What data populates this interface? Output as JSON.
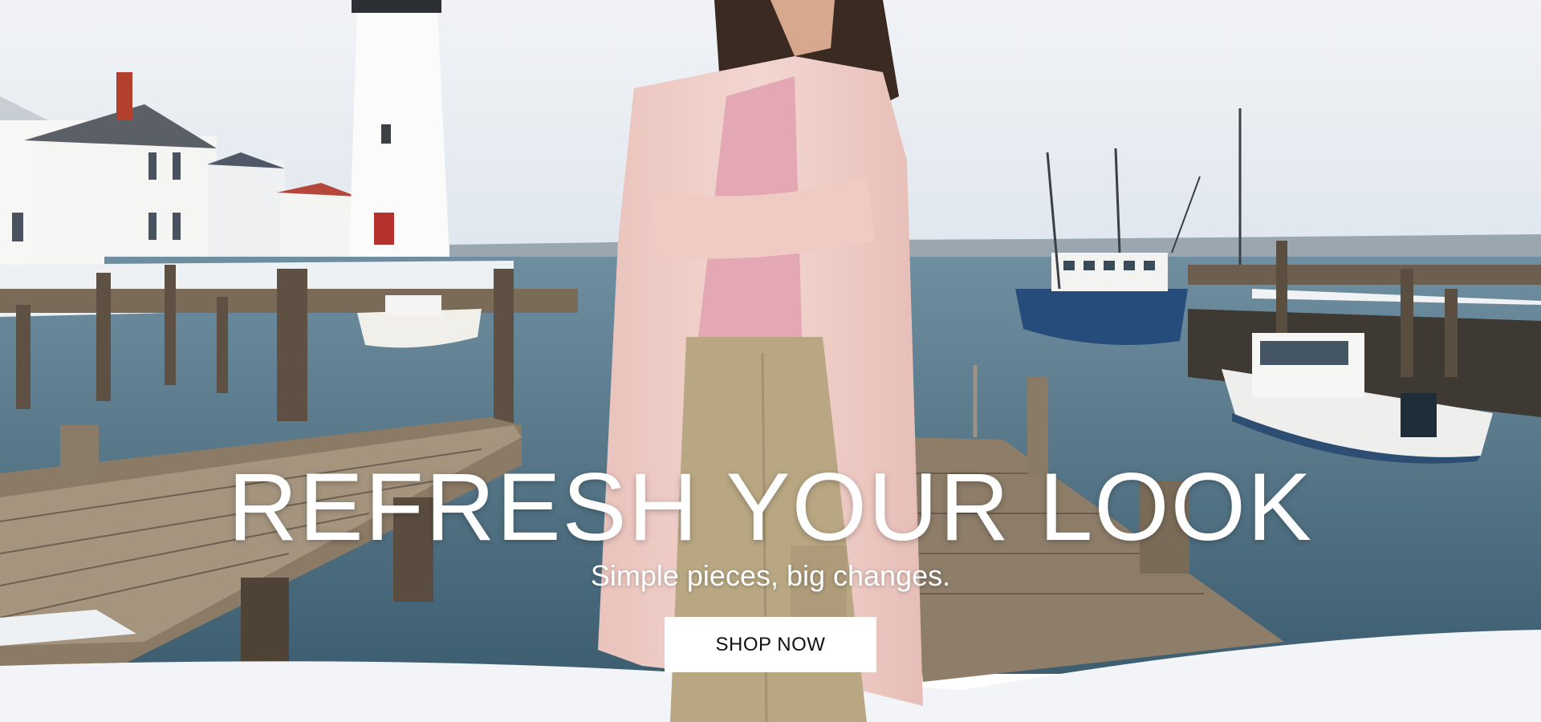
{
  "hero": {
    "headline": "REFRESH YOUR LOOK",
    "subheadline": "Simple pieces, big changes.",
    "cta_label": "SHOP NOW"
  },
  "image": {
    "description_tags": [
      "lighthouse",
      "houses",
      "wooden-pier",
      "boats",
      "harbor",
      "snow",
      "model-in-pink-coat"
    ]
  },
  "colors": {
    "sky": "#e6ecf2",
    "water": "#4d6f80",
    "snow": "#f4f6f8",
    "coat": "#efcfc9",
    "pants": "#bba98a",
    "button_bg": "#ffffff",
    "button_text": "#111111",
    "text": "#ffffff"
  }
}
